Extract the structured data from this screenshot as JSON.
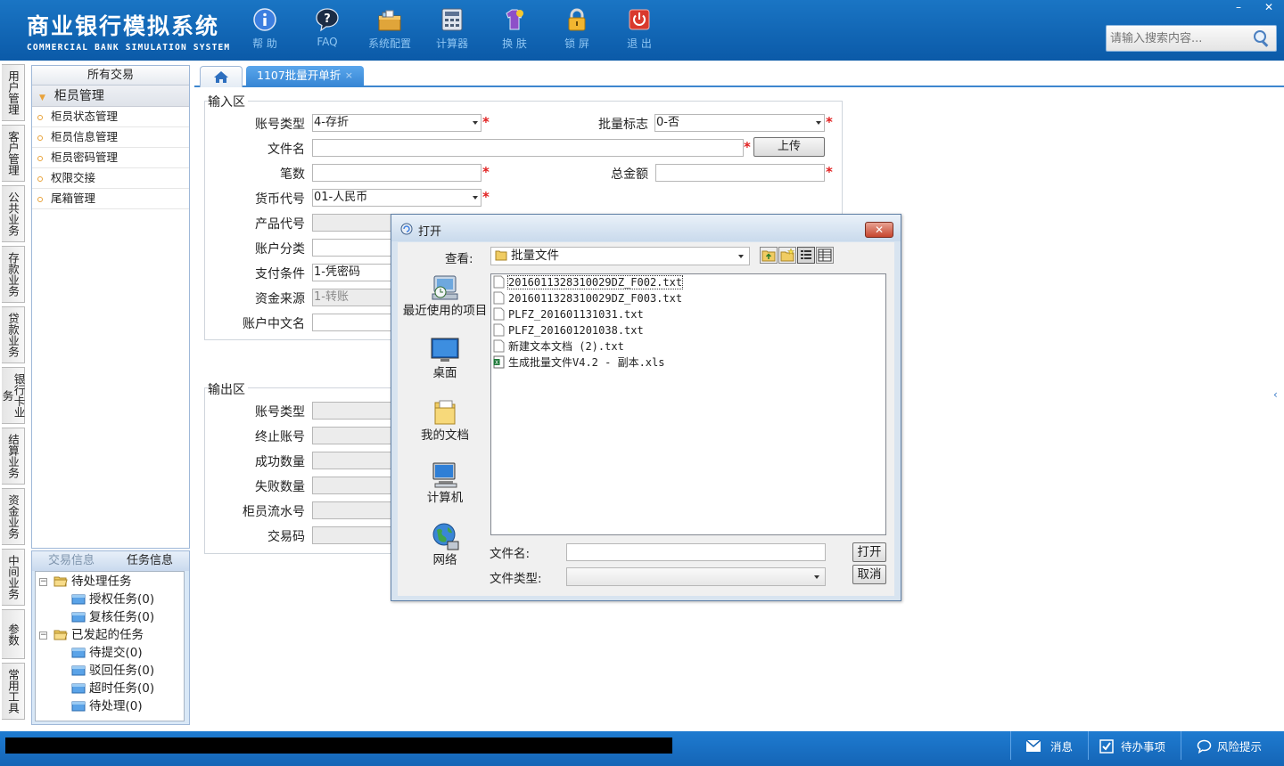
{
  "header": {
    "title_cn": "商业银行模拟系统",
    "title_en": "COMMERCIAL BANK SIMULATION SYSTEM",
    "toolbar": [
      {
        "label": "帮 助",
        "icon": "help-icon"
      },
      {
        "label": "FAQ",
        "icon": "faq-icon"
      },
      {
        "label": "系统配置",
        "icon": "settings-icon"
      },
      {
        "label": "计算器",
        "icon": "calculator-icon"
      },
      {
        "label": "换 肤",
        "icon": "skin-icon"
      },
      {
        "label": "锁 屏",
        "icon": "lock-icon"
      },
      {
        "label": "退 出",
        "icon": "power-icon"
      }
    ],
    "search_placeholder": "请输入搜索内容...",
    "minimize": "–",
    "close": "✕"
  },
  "left_nav": [
    "用户管理",
    "客户管理",
    "公共业务",
    "存款业务",
    "贷款业务",
    "银行卡业务",
    "结算业务",
    "资金业务",
    "中间业务",
    "参数",
    "常用工具"
  ],
  "tree": {
    "header": "所有交易",
    "group": "柜员管理",
    "items": [
      "柜员状态管理",
      "柜员信息管理",
      "柜员密码管理",
      "权限交接",
      "尾箱管理"
    ]
  },
  "task_panel": {
    "tabs": [
      "交易信息",
      "任务信息"
    ],
    "nodes": [
      {
        "label": "待处理任务"
      },
      {
        "label": "授权任务(0)"
      },
      {
        "label": "复核任务(0)"
      },
      {
        "label": "已发起的任务"
      },
      {
        "label": "待提交(0)"
      },
      {
        "label": "驳回任务(0)"
      },
      {
        "label": "超时任务(0)"
      },
      {
        "label": "待处理(0)"
      }
    ]
  },
  "tabs": {
    "active": "1107批量开单折",
    "close": "×"
  },
  "input_section": {
    "title": "输入区",
    "account_type_label": "账号类型",
    "account_type_value": "4-存折",
    "batch_flag_label": "批量标志",
    "batch_flag_value": "0-否",
    "file_name_label": "文件名",
    "upload_button": "上传",
    "count_label": "笔数",
    "total_amount_label": "总金额",
    "currency_label": "货币代号",
    "currency_value": "01-人民币",
    "product_code_label": "产品代号",
    "account_class_label": "账户分类",
    "payment_cond_label": "支付条件",
    "payment_cond_value": "1-凭密码",
    "fund_source_label": "资金来源",
    "fund_source_value": "1-转账",
    "account_cn_name_label": "账户中文名",
    "required": "*"
  },
  "output_section": {
    "title": "输出区",
    "labels": [
      "账号类型",
      "终止账号",
      "成功数量",
      "失败数量",
      "柜员流水号",
      "交易码"
    ]
  },
  "dialog": {
    "title": "打开",
    "close": "✕",
    "lookin_label": "查看:",
    "lookin_value": "批量文件",
    "places": [
      {
        "label": "最近使用的项目",
        "icon": "recent-items-icon"
      },
      {
        "label": "桌面",
        "icon": "desktop-icon"
      },
      {
        "label": "我的文档",
        "icon": "my-documents-icon"
      },
      {
        "label": "计算机",
        "icon": "computer-icon"
      },
      {
        "label": "网络",
        "icon": "network-icon"
      }
    ],
    "files": [
      {
        "name": "201601132831002 9DZ_F002.txt",
        "type": "txt"
      },
      {
        "name": "2016011328310029DZ_F003.txt",
        "type": "txt"
      },
      {
        "name": "PLFZ_201601131031.txt",
        "type": "txt"
      },
      {
        "name": "PLFZ_201601201038.txt",
        "type": "txt"
      },
      {
        "name": "新建文本文档 (2).txt",
        "type": "txt"
      },
      {
        "name": "生成批量文件V4.2 - 副本.xls",
        "type": "xls"
      }
    ],
    "filename_label": "文件名:",
    "filetype_label": "文件类型:",
    "open_button": "打开",
    "cancel_button": "取消"
  },
  "status_bar": {
    "messages": "消息",
    "todo": "待办事项",
    "risk": "风险提示"
  }
}
